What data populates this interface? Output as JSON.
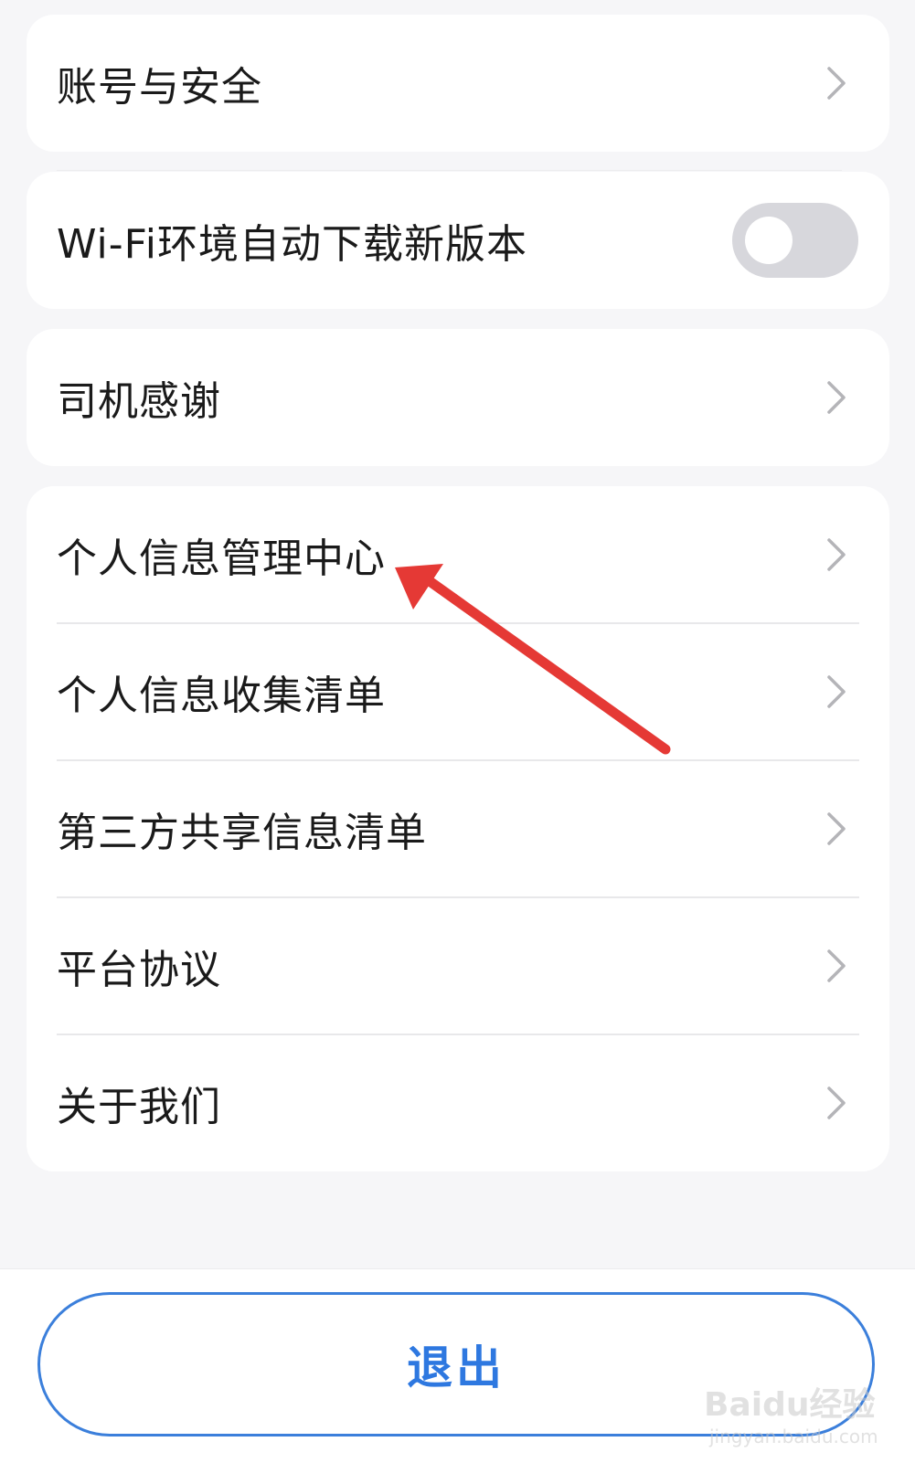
{
  "settings": {
    "items": [
      {
        "label": "账号与安全"
      },
      {
        "label": "Wi-Fi环境自动下载新版本",
        "toggle_on": false
      },
      {
        "label": "司机感谢"
      },
      {
        "label": "个人信息管理中心"
      },
      {
        "label": "个人信息收集清单"
      },
      {
        "label": "第三方共享信息清单"
      },
      {
        "label": "平台协议"
      },
      {
        "label": "关于我们"
      }
    ]
  },
  "footer": {
    "logout_label": "退出"
  },
  "annotation": {
    "arrow_color": "#e53935",
    "points_to": "个人信息管理中心"
  },
  "watermark": {
    "brand": "Baidu经验",
    "url": "jingyan.baidu.com"
  },
  "colors": {
    "accent": "#2e78e0",
    "background": "#f6f6f8",
    "toggle_off": "#d7d7dc"
  },
  "icons": {
    "row_chevron": "chevron-right-icon"
  }
}
